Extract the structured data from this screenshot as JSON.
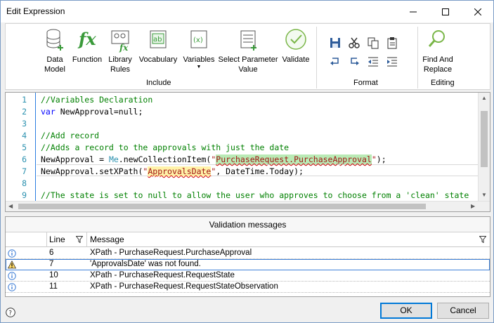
{
  "window": {
    "title": "Edit Expression"
  },
  "ribbon": {
    "include_buttons": [
      {
        "label": "Data\nModel",
        "icon": "data-model-icon"
      },
      {
        "label": "Function",
        "icon": "function-icon"
      },
      {
        "label": "Library\nRules",
        "icon": "library-rules-icon"
      },
      {
        "label": "Vocabulary",
        "icon": "vocabulary-icon"
      },
      {
        "label": "Variables",
        "icon": "variables-icon"
      },
      {
        "label": "Select Parameter\nValue",
        "icon": "select-parameter-icon"
      },
      {
        "label": "Validate",
        "icon": "validate-icon"
      }
    ],
    "include_label": "Include",
    "format_label": "Format",
    "editing_button": {
      "label": "Find And\nReplace",
      "icon": "find-replace-icon"
    },
    "editing_label": "Editing",
    "format_icons": [
      "save-icon",
      "cut-icon",
      "copy-icon",
      "paste-icon",
      "undo-icon",
      "redo-icon",
      "outdent-icon",
      "indent-icon"
    ]
  },
  "editor": {
    "line_numbers": [
      "1",
      "2",
      "3",
      "4",
      "5",
      "6",
      "7",
      "8",
      "9"
    ],
    "lines": {
      "l1": "//Variables Declaration",
      "l2_kw": "var",
      "l2_rest": " NewApproval=null;",
      "l4": "//Add record",
      "l5": "//Adds a record to the approvals with just the date",
      "l6_a": "NewApproval = ",
      "l6_obj": "Me",
      "l6_b": ".newCollectionItem(",
      "l6_q1": "\"",
      "l6_str": "PurchaseRequest.PurchaseApproval",
      "l6_q2": "\"",
      "l6_c": ");",
      "l7_a": "NewApproval.setXPath(",
      "l7_q1": "\"",
      "l7_str": "ApprovalsDate",
      "l7_q2": "\"",
      "l7_c": ", DateTime.Today);",
      "l9": "//The state is set to null to allow the user who approves to choose from a 'clean' state"
    }
  },
  "validation": {
    "title": "Validation messages",
    "columns": {
      "line": "Line",
      "message": "Message"
    },
    "rows": [
      {
        "type": "info",
        "icon": "info-icon",
        "line": "6",
        "message": "XPath - PurchaseRequest.PurchaseApproval"
      },
      {
        "type": "warning",
        "icon": "warning-icon",
        "line": "7",
        "message": "'ApprovalsDate'  was not found."
      },
      {
        "type": "info",
        "icon": "info-icon",
        "line": "10",
        "message": "XPath - PurchaseRequest.RequestState"
      },
      {
        "type": "info",
        "icon": "info-icon",
        "line": "11",
        "message": "XPath - PurchaseRequest.RequestStateObservation"
      }
    ]
  },
  "footer": {
    "ok_label": "OK",
    "cancel_label": "Cancel"
  },
  "colors": {
    "accent": "#0078d7",
    "comment": "#008000",
    "keyword": "#0000ff",
    "string": "#a31515",
    "line_number": "#2b91af"
  }
}
